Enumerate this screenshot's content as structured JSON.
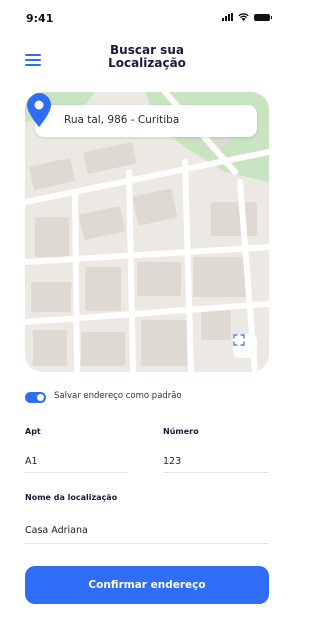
{
  "status_bar": {
    "time": "9:41"
  },
  "header": {
    "title_line1": "Buscar sua",
    "title_line2": "Localização"
  },
  "map": {
    "search_value": "Rua tal, 986 - Curitiba"
  },
  "save_default": {
    "label": "Salvar endereço como padrão",
    "checked": true
  },
  "fields": {
    "apt": {
      "label": "Apt",
      "value": "A1"
    },
    "numero": {
      "label": "Número",
      "value": "123"
    },
    "nome": {
      "label": "Nome da localização",
      "value": "Casa Adriana"
    }
  },
  "confirm_label": "Confirmar endereço",
  "colors": {
    "accent": "#2f6df6",
    "park": "#c9e4c0",
    "map_bg": "#ece9e4",
    "road": "#ffffff"
  }
}
